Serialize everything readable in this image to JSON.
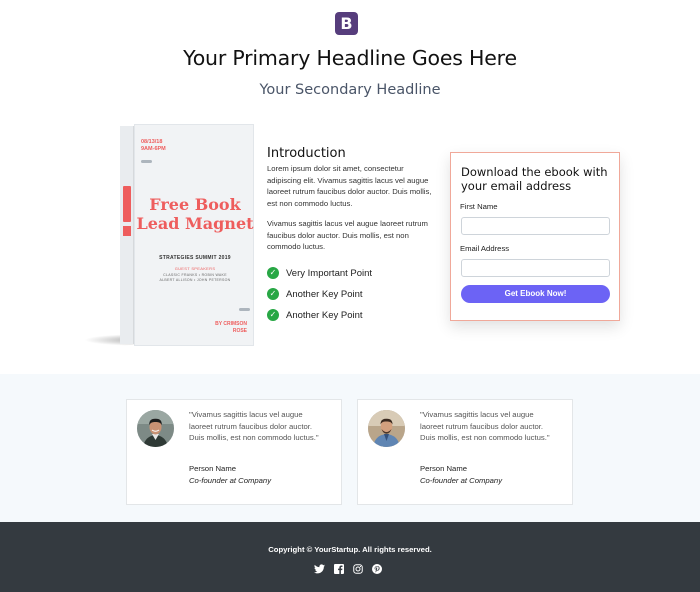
{
  "header": {
    "logo_letter": "B",
    "headline": "Your Primary Headline Goes Here",
    "subheadline": "Your Secondary Headline"
  },
  "book": {
    "date": "08/13/18",
    "time": "9AM-6PM",
    "title_line1": "Free Book",
    "title_line2": "Lead Magnet",
    "event": "STRATEGIES SUMMIT 2019",
    "guest_label": "GUEST SPEAKERS",
    "speakers_line1": "CLASSIC FRANKS • ROBIN WAKE",
    "speakers_line2": "ALBERT ALLISON • JOHN PETERSON",
    "author_line1": "BY CRIMSON",
    "author_line2": "ROSE"
  },
  "intro": {
    "title": "Introduction",
    "paragraph1": "Lorem ipsum dolor sit amet, consectetur adipiscing elit. Vivamus sagittis lacus vel augue laoreet rutrum faucibus dolor auctor. Duis mollis, est non commodo luctus.",
    "paragraph2": "Vivamus sagittis lacus vel augue laoreet rutrum faucibus dolor auctor. Duis mollis, est non commodo luctus.",
    "points": [
      "Very Important Point",
      "Another Key Point",
      "Another Key Point"
    ]
  },
  "form": {
    "title": "Download the ebook with your email address",
    "first_name_label": "First Name",
    "first_name_value": "",
    "email_label": "Email Address",
    "email_value": "",
    "button_label": "Get Ebook Now!"
  },
  "testimonials": [
    {
      "quote": "\"Vivamus sagittis lacus vel augue laoreet rutrum faucibus dolor auctor. Duis mollis, est non commodo luctus.\"",
      "name": "Person Name",
      "role": "Co-founder at Company"
    },
    {
      "quote": "\"Vivamus sagittis lacus vel augue laoreet rutrum faucibus dolor auctor. Duis mollis, est non commodo luctus.\"",
      "name": "Person Name",
      "role": "Co-founder at Company"
    }
  ],
  "footer": {
    "copyright": "Copyright © YourStartup. All rights reserved.",
    "social_icons": [
      "twitter-icon",
      "facebook-icon",
      "instagram-icon",
      "pinterest-icon"
    ]
  },
  "colors": {
    "brand": "#563d7c",
    "accent_button": "#6c63f5",
    "check_green": "#28a745",
    "book_red": "#ee5d5d",
    "footer_bg": "#343a40"
  }
}
